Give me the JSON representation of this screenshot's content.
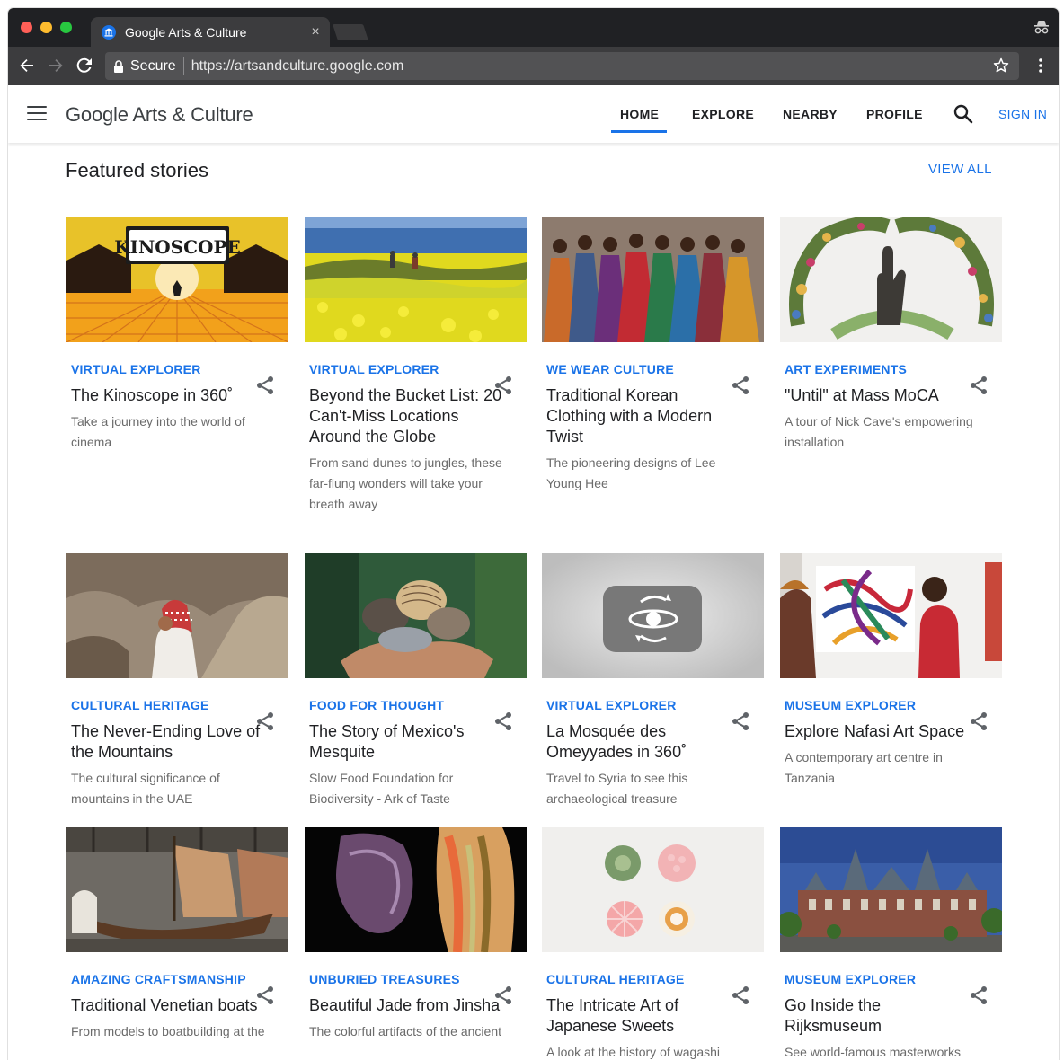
{
  "browser": {
    "tab_title": "Google Arts & Culture",
    "tab_close": "×",
    "secure_label": "Secure",
    "url": "https://artsandculture.google.com"
  },
  "header": {
    "logo_google": "Google",
    "logo_rest": "Arts & Culture",
    "nav": [
      "HOME",
      "EXPLORE",
      "NEARBY",
      "PROFILE"
    ],
    "active_nav": "HOME",
    "sign_in": "SIGN IN",
    "accent_color": "#1a73e8"
  },
  "section": {
    "title": "Featured stories",
    "view_all": "VIEW ALL"
  },
  "cards": [
    {
      "category": "VIRTUAL EXPLORER",
      "title": "The Kinoscope in 360˚",
      "desc": "Take a journey into the world of cinema",
      "thumb_text": "KINOSCOPE"
    },
    {
      "category": "VIRTUAL EXPLORER",
      "title": "Beyond the Bucket List: 20 Can't-Miss Locations Around the Globe",
      "desc": "From sand dunes to jungles, these far-flung wonders will take your breath away"
    },
    {
      "category": "WE WEAR CULTURE",
      "title": "Traditional Korean Clothing with a Modern Twist",
      "desc": "The pioneering designs of Lee Young Hee"
    },
    {
      "category": "ART EXPERIMENTS",
      "title": "\"Until\" at Mass MoCA",
      "desc": "A tour of Nick Cave's empowering installation"
    },
    {
      "category": "CULTURAL HERITAGE",
      "title": "The Never-Ending Love of the Mountains",
      "desc": "The cultural significance of mountains in the UAE"
    },
    {
      "category": "FOOD FOR THOUGHT",
      "title": "The Story of Mexico's Mesquite",
      "desc": "Slow Food Foundation for Biodiversity - Ark of Taste"
    },
    {
      "category": "VIRTUAL EXPLORER",
      "title": "La Mosquée des Omeyyades in 360˚",
      "desc": "Travel to Syria to see this archaeological treasure"
    },
    {
      "category": "MUSEUM EXPLORER",
      "title": "Explore Nafasi Art Space",
      "desc": "A contemporary art centre in Tanzania"
    },
    {
      "category": "AMAZING CRAFTSMANSHIP",
      "title": "Traditional Venetian boats",
      "desc": "From models to boatbuilding at the"
    },
    {
      "category": "UNBURIED TREASURES",
      "title": "Beautiful Jade from Jinsha",
      "desc": "The colorful artifacts of the ancient"
    },
    {
      "category": "CULTURAL HERITAGE",
      "title": "The Intricate Art of Japanese Sweets",
      "desc": "A look at the history of wagashi"
    },
    {
      "category": "MUSEUM EXPLORER",
      "title": "Go Inside the Rijksmuseum",
      "desc": "See world-famous masterworks"
    }
  ]
}
